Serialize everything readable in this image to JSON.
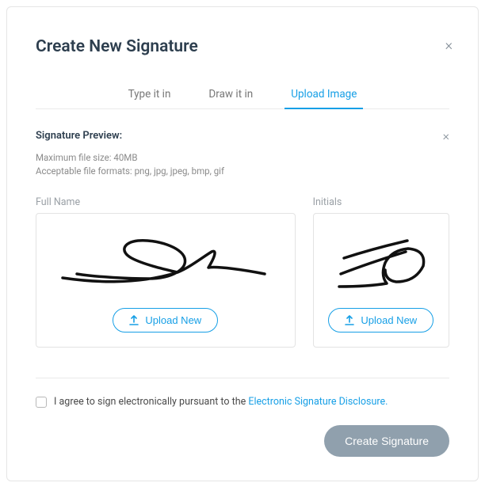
{
  "modal": {
    "title": "Create New Signature"
  },
  "tabs": {
    "type": "Type it in",
    "draw": "Draw it in",
    "upload": "Upload Image"
  },
  "preview": {
    "label": "Signature Preview:",
    "hint_size": "Maximum file size: 40MB",
    "hint_formats": "Acceptable file formats: png, jpg, jpeg, bmp, gif"
  },
  "fields": {
    "fullname_label": "Full Name",
    "initials_label": "Initials",
    "upload_button": "Upload New"
  },
  "consent": {
    "text_prefix": "I agree to sign electronically pursuant to the ",
    "link_text": "Electronic Signature Disclosure."
  },
  "actions": {
    "create": "Create Signature"
  }
}
